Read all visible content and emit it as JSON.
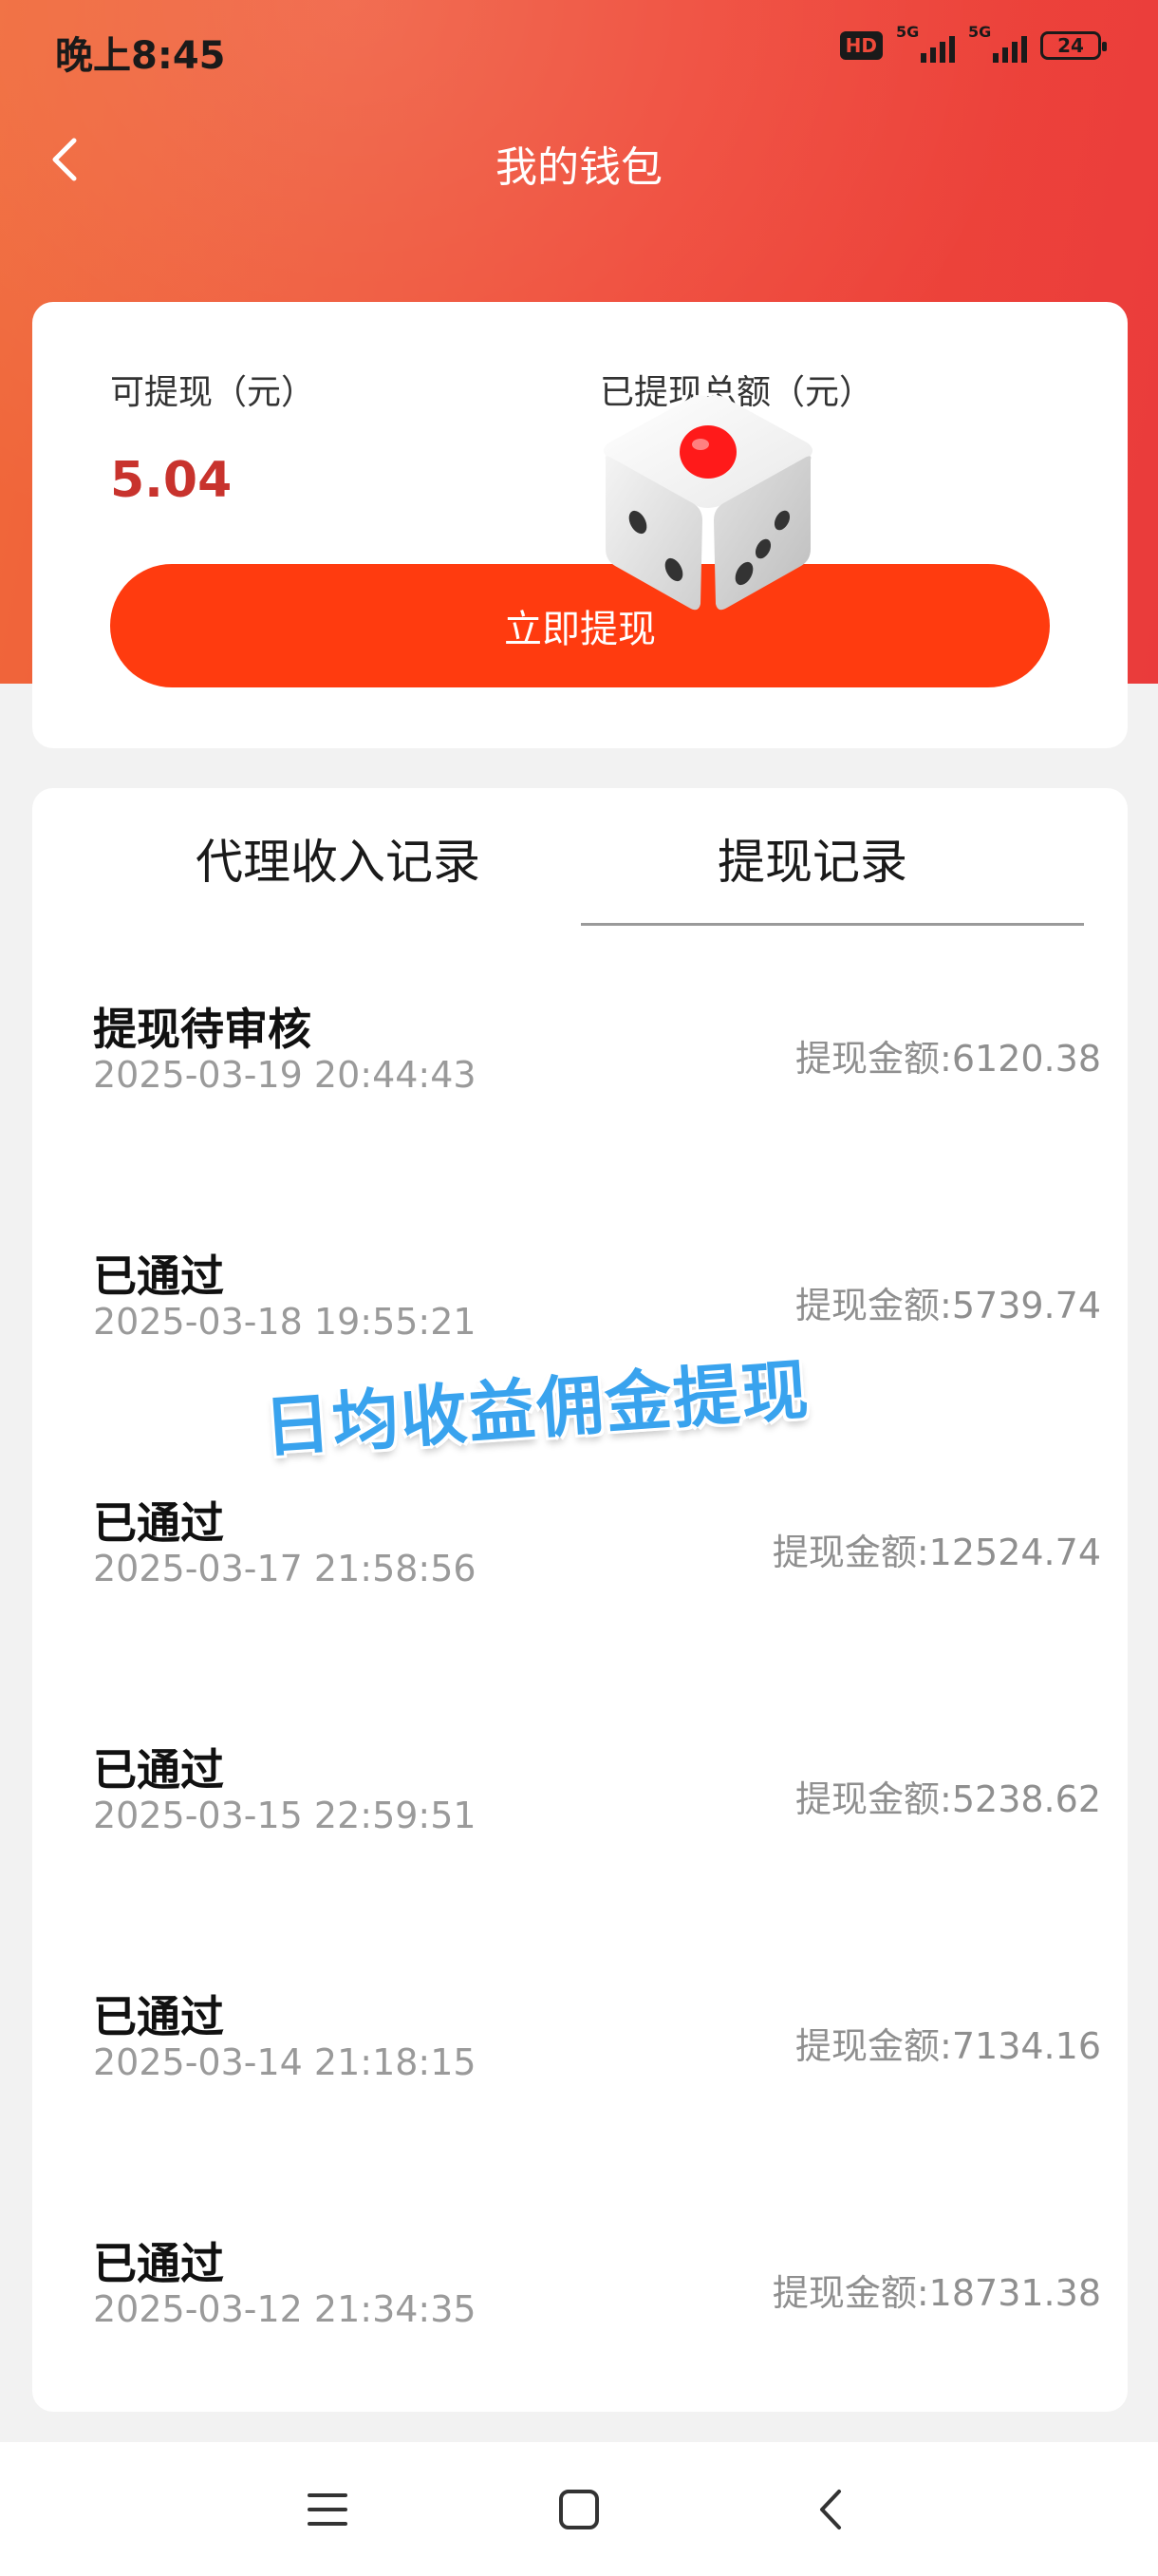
{
  "status_bar": {
    "time": "晚上8:45",
    "hd": "HD",
    "net1": "5G",
    "net2": "5G",
    "battery": "24"
  },
  "header": {
    "title": "我的钱包"
  },
  "wallet": {
    "withdrawable_label": "可提现（元）",
    "withdrawable_value": "5.04",
    "total_label": "已提现总额（元）",
    "withdraw_button": "立即提现"
  },
  "tabs": [
    {
      "label": "代理收入记录",
      "active": false
    },
    {
      "label": "提现记录",
      "active": true
    }
  ],
  "records": [
    {
      "status": "提现待审核",
      "time": "2025-03-19 20:44:43",
      "amount": "提现金额:6120.38"
    },
    {
      "status": "已通过",
      "time": "2025-03-18 19:55:21",
      "amount": "提现金额:5739.74"
    },
    {
      "status": "已通过",
      "time": "2025-03-17 21:58:56",
      "amount": "提现金额:12524.74"
    },
    {
      "status": "已通过",
      "time": "2025-03-15 22:59:51",
      "amount": "提现金额:5238.62"
    },
    {
      "status": "已通过",
      "time": "2025-03-14 21:18:15",
      "amount": "提现金额:7134.16"
    },
    {
      "status": "已通过",
      "time": "2025-03-12 21:34:35",
      "amount": "提现金额:18731.38"
    }
  ],
  "overlay": {
    "caption": "日均收益佣金提现"
  },
  "colors": {
    "header": "#ef4a3a",
    "button": "#ff3b0f",
    "amount_red": "#c8332d",
    "caption_blue": "#39a3ee"
  },
  "icons": {
    "back": "chevron-left-icon",
    "dice": "dice-icon",
    "menu": "menu-icon",
    "home": "home-square-icon",
    "nav_back": "back-chevron-icon"
  }
}
